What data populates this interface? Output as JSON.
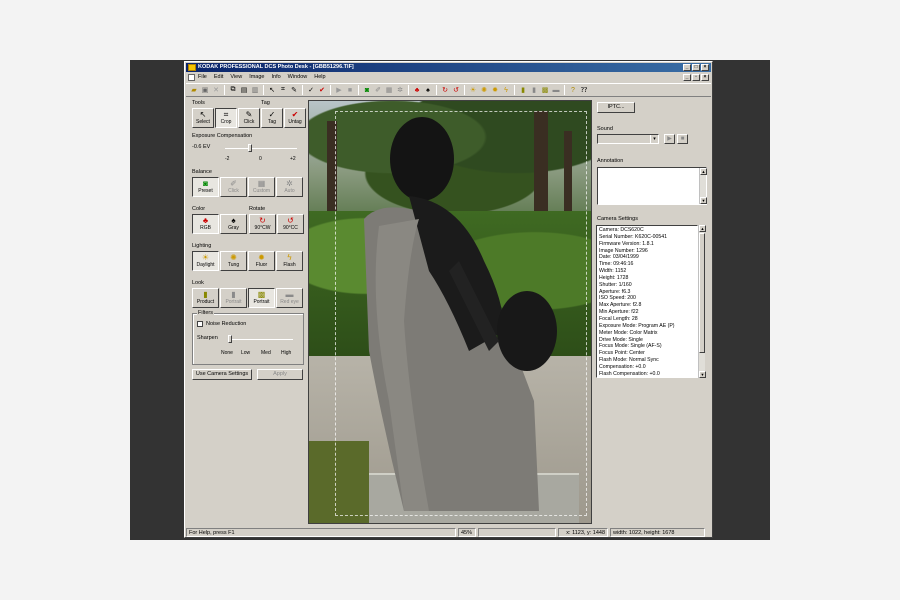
{
  "window": {
    "title": "KODAK PROFESSIONAL DCS Photo Desk - [GBB51296.TIF]"
  },
  "menu": [
    "File",
    "Edit",
    "View",
    "Image",
    "Info",
    "Window",
    "Help"
  ],
  "tools": {
    "heading": "Tools",
    "tag_heading": "Tag",
    "select": "Select",
    "crop": "Crop",
    "click": "Click",
    "tag": "Tag",
    "untag": "Untag"
  },
  "exposure": {
    "heading": "Exposure Compensation",
    "value": "-0.6 EV",
    "tick_min": "-2",
    "tick_mid": "0",
    "tick_max": "+2",
    "level": -0.6
  },
  "balance": {
    "heading": "Balance",
    "preset": "Preset",
    "click": "Click",
    "custom": "Custom",
    "auto": "Auto"
  },
  "color": {
    "heading": "Color",
    "rgb": "RGB",
    "gray": "Gray"
  },
  "rotate": {
    "heading": "Rotate",
    "cw": "90°CW",
    "ccw": "90°CC"
  },
  "lighting": {
    "heading": "Lighting",
    "daylight": "Daylight",
    "tung": "Tung",
    "fluor": "Fluor",
    "flash": "Flash"
  },
  "look": {
    "heading": "Look",
    "product": "Product",
    "portrait_a": "Portrait",
    "portrait_b": "Portrait",
    "red_eye": "Red eye"
  },
  "filters": {
    "heading": "Filters",
    "noise_reduction": "Noise Reduction",
    "sharpen": "Sharpen",
    "levels": [
      "None",
      "Low",
      "Med",
      "High"
    ]
  },
  "bottom_buttons": {
    "use_camera_settings": "Use Camera Settings",
    "apply": "Apply"
  },
  "right_panel": {
    "iptc": "IPTC...",
    "sound": "Sound",
    "annotation": "Annotation",
    "camera_settings": "Camera Settings",
    "settings_lines": [
      "Camera:  DCS620C",
      "Serial Number:  K620C-00541",
      "Firmware Version:  1.8.1",
      "Image Number:  1296",
      "Date:  03/04/1999",
      "Time:  09:46:16",
      "Width:  1152",
      "Height:  1728",
      "Shutter:  1/160",
      "Aperture:  f6.3",
      "ISO Speed:  200",
      "Max Aperture:  f2.8",
      "Min Aperture:  f22",
      "Focal Length:  28",
      "Exposure Mode:  Program AE (P)",
      "Meter Mode:  Color Matrix",
      "Drive Mode:  Single",
      "Focus Mode:  Single (AF-S)",
      "Focus Point:  Center",
      "Flash Mode:  Normal Sync",
      "Compensation:  +0.0",
      "Flash Compensation:  +0.0"
    ]
  },
  "status": {
    "help": "For Help, press F1",
    "zoom": "45%",
    "coords": "x: 1123,  y: 1448",
    "size": "width: 1022, height: 1678"
  },
  "colors": {
    "title_start": "#0a246a",
    "title_end": "#3a6ea5",
    "face": "#d4d0c8"
  }
}
